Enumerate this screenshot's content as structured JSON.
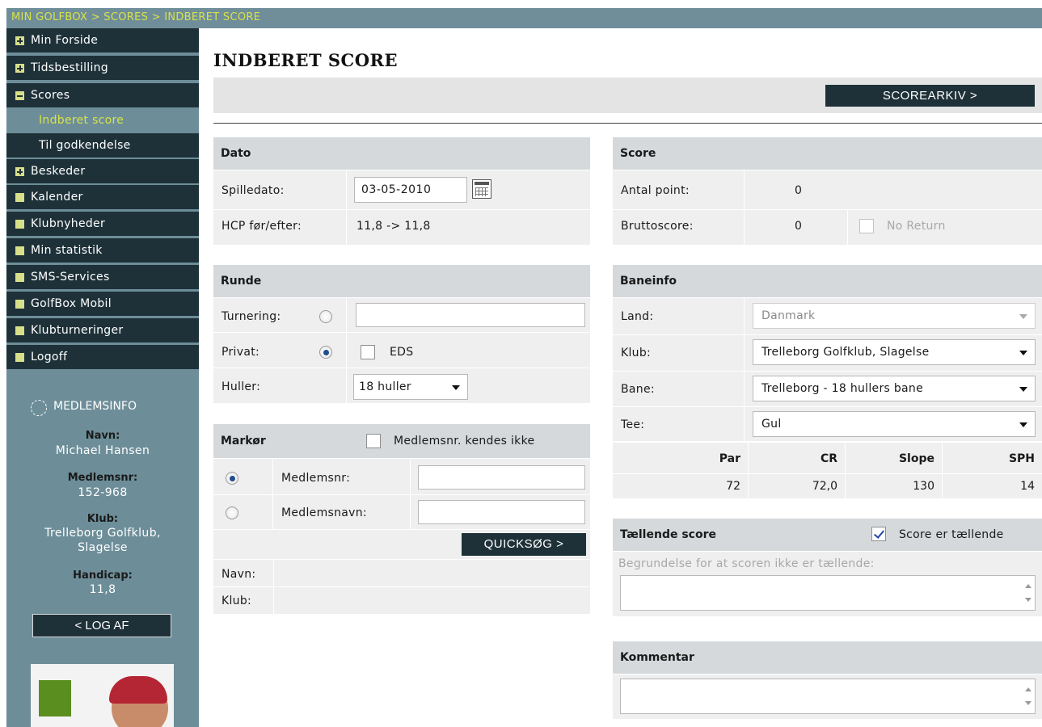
{
  "breadcrumb": "MIN GOLFBOX > SCORES > INDBERET SCORE",
  "nav": {
    "min_forside": "Min Forside",
    "tidsbestilling": "Tidsbestilling",
    "scores": "Scores",
    "indberet_score": "Indberet score",
    "til_godkendelse": "Til godkendelse",
    "beskeder": "Beskeder",
    "kalender": "Kalender",
    "klubnyheder": "Klubnyheder",
    "min_statistik": "Min statistik",
    "sms_services": "SMS-Services",
    "golfbox_mobil": "GolfBox Mobil",
    "klubturneringer": "Klubturneringer",
    "logoff": "Logoff"
  },
  "member": {
    "heading": "MEDLEMSINFO",
    "navn_label": "Navn:",
    "navn": "Michael Hansen",
    "medlemsnr_label": "Medlemsnr:",
    "medlemsnr": "152-968",
    "klub_label": "Klub:",
    "klub_line1": "Trelleborg Golfklub,",
    "klub_line2": "Slagelse",
    "handicap_label": "Handicap:",
    "handicap": "11,8",
    "logout": "< LOG AF"
  },
  "page": {
    "title": "INDBERET SCORE",
    "scorearkiv": "SCOREARKIV >"
  },
  "dato": {
    "heading": "Dato",
    "spilledato_label": "Spilledato:",
    "spilledato": "03-05-2010",
    "hcp_label": "HCP før/efter:",
    "hcp": "11,8 -> 11,8"
  },
  "runde": {
    "heading": "Runde",
    "turnering_label": "Turnering:",
    "turnering_value": "",
    "privat_label": "Privat:",
    "eds_label": "EDS",
    "huller_label": "Huller:",
    "huller": "18 huller"
  },
  "markoer": {
    "heading": "Markør",
    "unknown_label": "Medlemsnr. kendes ikke",
    "medlemsnr_label": "Medlemsnr:",
    "medlemsnavn_label": "Medlemsnavn:",
    "quicksog": "QUICKSØG >",
    "navn_label": "Navn:",
    "klub_label": "Klub:"
  },
  "score": {
    "heading": "Score",
    "antal_point_label": "Antal point:",
    "antal_point": "0",
    "brutto_label": "Bruttoscore:",
    "brutto": "0",
    "no_return": "No Return"
  },
  "baneinfo": {
    "heading": "Baneinfo",
    "land_label": "Land:",
    "land": "Danmark",
    "klub_label": "Klub:",
    "klub": "Trelleborg Golfklub, Slagelse",
    "bane_label": "Bane:",
    "bane": "Trelleborg - 18 hullers bane",
    "tee_label": "Tee:",
    "tee": "Gul",
    "par_h": "Par",
    "cr_h": "CR",
    "slope_h": "Slope",
    "sph_h": "SPH",
    "par": "72",
    "cr": "72,0",
    "slope": "130",
    "sph": "14"
  },
  "taellende": {
    "heading": "Tællende score",
    "check_label": "Score er tællende",
    "begrundelse": "Begrundelse for at scoren ikke er tællende:"
  },
  "kommentar": {
    "heading": "Kommentar"
  }
}
